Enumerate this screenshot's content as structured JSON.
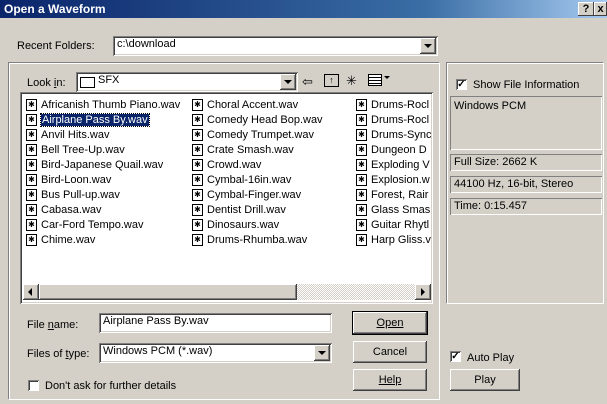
{
  "window": {
    "title": "Open a Waveform",
    "help_btn": "?",
    "close_btn": "x"
  },
  "recent": {
    "label": "Recent Folders:",
    "value": "c:\\download"
  },
  "lookin": {
    "label": "Look in:",
    "value": "SFX"
  },
  "files": {
    "col1": [
      "Africanish Thumb Piano.wav",
      "Airplane Pass By.wav",
      "Anvil Hits.wav",
      "Bell Tree-Up.wav",
      "Bird-Japanese Quail.wav",
      "Bird-Loon.wav",
      "Bus Pull-up.wav",
      "Cabasa.wav",
      "Car-Ford Tempo.wav",
      "Chime.wav"
    ],
    "col2": [
      "Choral Accent.wav",
      "Comedy Head Bop.wav",
      "Comedy Trumpet.wav",
      "Crate Smash.wav",
      "Crowd.wav",
      "Cymbal-16in.wav",
      "Cymbal-Finger.wav",
      "Dentist Drill.wav",
      "Dinosaurs.wav",
      "Drums-Rhumba.wav"
    ],
    "col3": [
      "Drums-Rocl",
      "Drums-Rocl",
      "Drums-Sync",
      "Dungeon D",
      "Exploding V",
      "Explosion.w",
      "Forest, Rair",
      "Glass Smas",
      "Guitar Rhytl",
      "Harp Gliss.v"
    ],
    "selected_index": 1
  },
  "filename": {
    "label": "File name:",
    "value": "Airplane Pass By.wav"
  },
  "filetype": {
    "label": "Files of type:",
    "value": "Windows PCM (*.wav)"
  },
  "dont_ask": {
    "label": "Don't ask for further details",
    "checked": false
  },
  "buttons": {
    "open": "Open",
    "cancel": "Cancel",
    "help": "Help",
    "play": "Play"
  },
  "info": {
    "show_label": "Show File Information",
    "show_checked": true,
    "format": "Windows PCM",
    "full_size": "Full Size: 2662 K",
    "rate": "44100 Hz, 16-bit, Stereo",
    "time": "Time:  0:15.457"
  },
  "autoplay": {
    "label": "Auto Play",
    "checked": true
  }
}
